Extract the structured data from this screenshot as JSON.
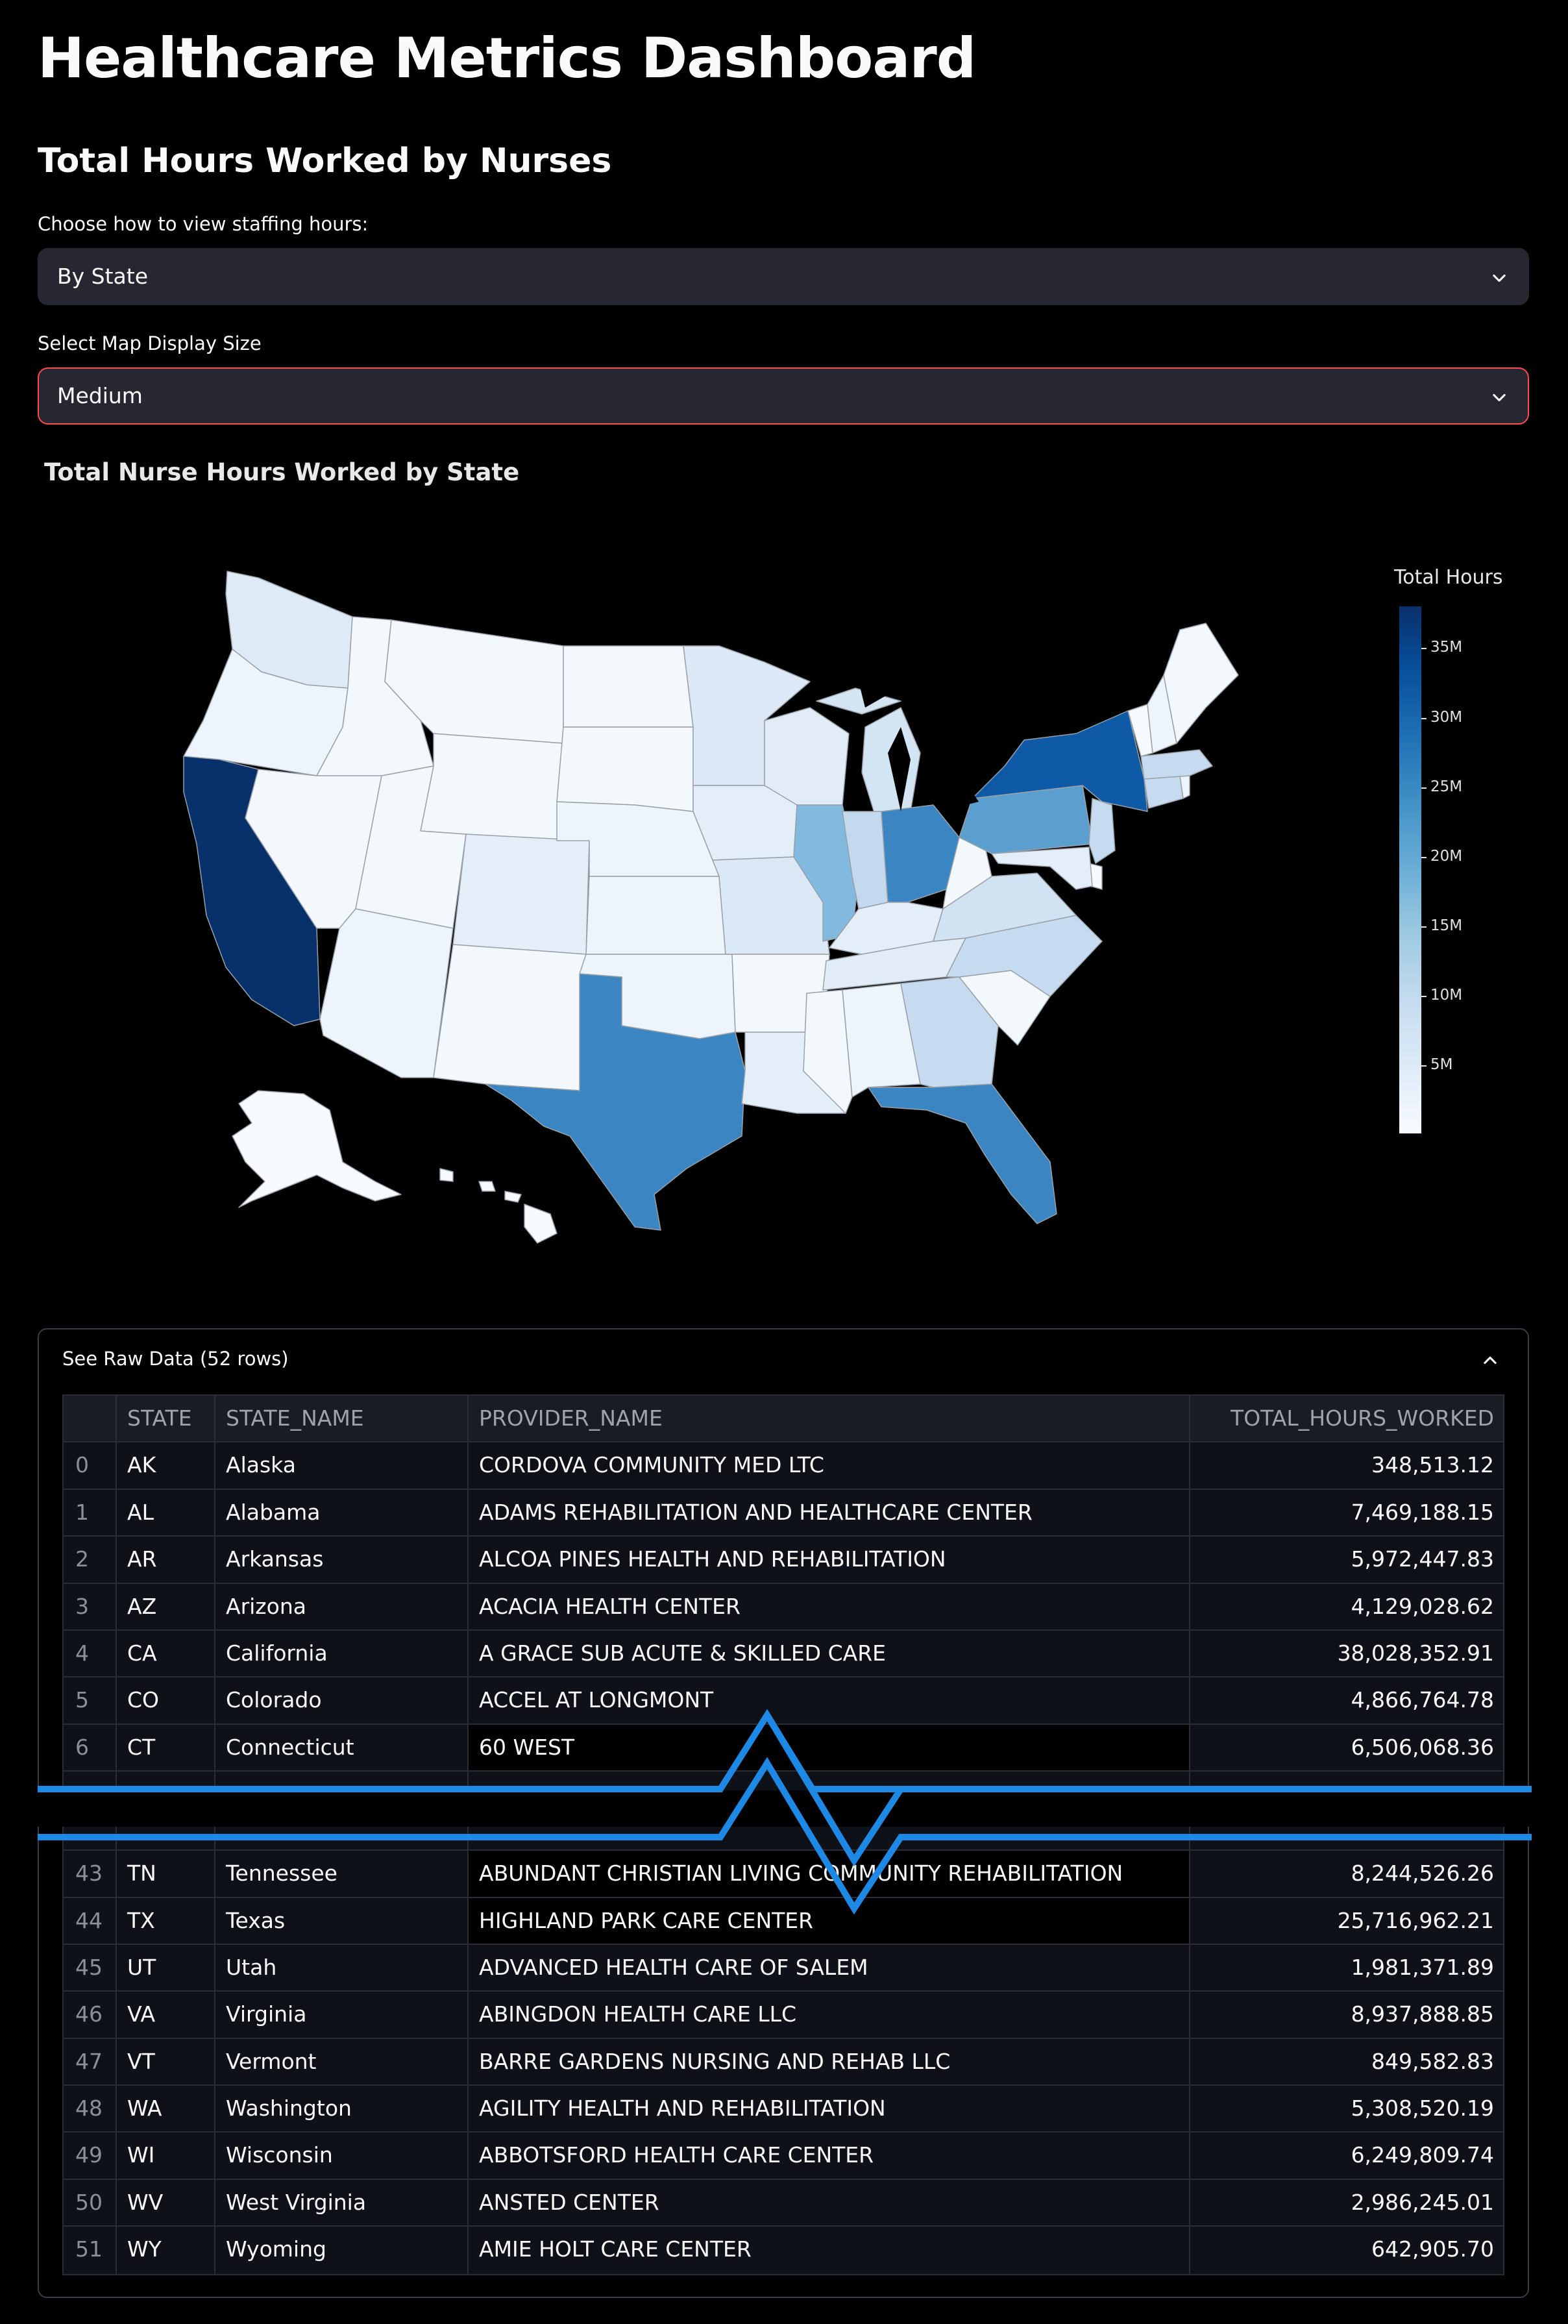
{
  "page": {
    "title": "Healthcare Metrics Dashboard",
    "subtitle": "Total Hours Worked by Nurses"
  },
  "controls": {
    "view_label": "Choose how to view staffing hours:",
    "view_value": "By State",
    "size_label": "Select Map Display Size",
    "size_value": "Medium"
  },
  "map": {
    "title": "Total Nurse Hours Worked by State",
    "legend_title": "Total Hours",
    "legend_ticks": [
      "35M",
      "30M",
      "25M",
      "20M",
      "15M",
      "10M",
      "5M"
    ],
    "colorscale": [
      "#f7fbff",
      "#deebf7",
      "#c6dbef",
      "#9ecae1",
      "#6baed6",
      "#4292c6",
      "#2171b5",
      "#08519c",
      "#08306b"
    ]
  },
  "raw_data": {
    "expander_label": "See Raw Data (52 rows)",
    "columns": [
      "",
      "STATE",
      "STATE_NAME",
      "PROVIDER_NAME",
      "TOTAL_HOURS_WORKED"
    ],
    "rows_top": [
      [
        "0",
        "AK",
        "Alaska",
        "CORDOVA COMMUNITY MED LTC",
        "348,513.12"
      ],
      [
        "1",
        "AL",
        "Alabama",
        "ADAMS REHABILITATION AND HEALTHCARE CENTER",
        "7,469,188.15"
      ],
      [
        "2",
        "AR",
        "Arkansas",
        "ALCOA PINES HEALTH AND REHABILITATION",
        "5,972,447.83"
      ],
      [
        "3",
        "AZ",
        "Arizona",
        "ACACIA HEALTH CENTER",
        "4,129,028.62"
      ],
      [
        "4",
        "CA",
        "California",
        "A GRACE SUB ACUTE & SKILLED CARE",
        "38,028,352.91"
      ],
      [
        "5",
        "CO",
        "Colorado",
        "ACCEL AT LONGMONT",
        "4,866,764.78"
      ],
      [
        "6",
        "CT",
        "Connecticut",
        "60 WEST",
        "6,506,068.36"
      ]
    ],
    "rows_bottom": [
      [
        "43",
        "TN",
        "Tennessee",
        "ABUNDANT CHRISTIAN LIVING COMMUNITY REHABILITATION",
        "8,244,526.26"
      ],
      [
        "44",
        "TX",
        "Texas",
        "HIGHLAND PARK CARE CENTER",
        "25,716,962.21"
      ],
      [
        "45",
        "UT",
        "Utah",
        "ADVANCED HEALTH CARE OF SALEM",
        "1,981,371.89"
      ],
      [
        "46",
        "VA",
        "Virginia",
        "ABINGDON HEALTH CARE LLC",
        "8,937,888.85"
      ],
      [
        "47",
        "VT",
        "Vermont",
        "BARRE GARDENS NURSING AND REHAB LLC",
        "849,582.83"
      ],
      [
        "48",
        "WA",
        "Washington",
        "AGILITY HEALTH AND REHABILITATION",
        "5,308,520.19"
      ],
      [
        "49",
        "WI",
        "Wisconsin",
        "ABBOTSFORD HEALTH CARE CENTER",
        "6,249,809.74"
      ],
      [
        "50",
        "WV",
        "West Virginia",
        "ANSTED CENTER",
        "2,986,245.01"
      ],
      [
        "51",
        "WY",
        "Wyoming",
        "AMIE HOLT CARE CENTER",
        "642,905.70"
      ]
    ]
  }
}
